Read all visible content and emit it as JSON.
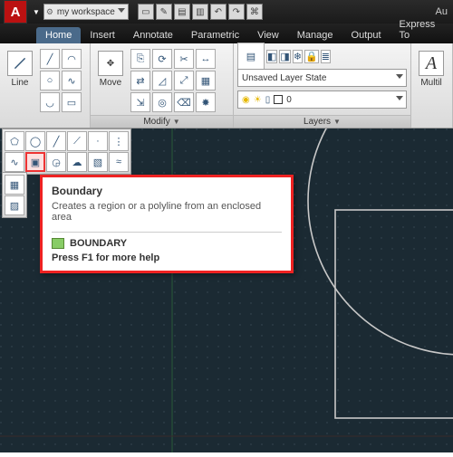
{
  "title_right": "Au",
  "workspace": {
    "label": "my workspace"
  },
  "tabs": [
    "Home",
    "Insert",
    "Annotate",
    "Parametric",
    "View",
    "Manage",
    "Output",
    "Express To"
  ],
  "active_tab": 0,
  "draw_panel": {
    "line_label": "Line"
  },
  "modify_panel": {
    "label": "Modify",
    "move_label": "Move"
  },
  "layers_panel": {
    "label": "Layers",
    "state_combo": "Unsaved Layer State",
    "current_combo": "0"
  },
  "right_stub": {
    "big_label": "Multil"
  },
  "tooltip": {
    "title": "Boundary",
    "desc": "Creates a region or a polyline from an enclosed area",
    "command": "BOUNDARY",
    "help": "Press F1 for more help"
  },
  "qat_icons": [
    "new",
    "open",
    "save",
    "saveas",
    "undo",
    "redo",
    "plot"
  ]
}
